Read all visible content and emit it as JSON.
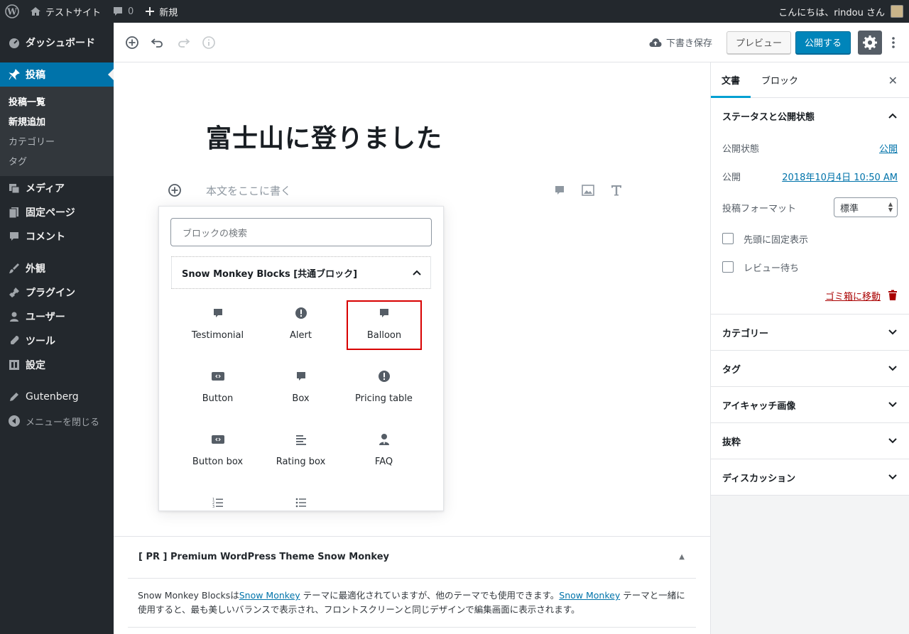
{
  "adminbar": {
    "site_name": "テストサイト",
    "comments_count": "0",
    "new_label": "新規",
    "greeting": "こんにちは、rindou さん"
  },
  "menu": {
    "dashboard": "ダッシュボード",
    "posts": "投稿",
    "sub": [
      "投稿一覧",
      "新規追加",
      "カテゴリー",
      "タグ"
    ],
    "media": "メディア",
    "pages": "固定ページ",
    "comments": "コメント",
    "appearance": "外観",
    "plugins": "プラグイン",
    "users": "ユーザー",
    "tools": "ツール",
    "settings": "設定",
    "gutenberg": "Gutenberg",
    "collapse": "メニューを閉じる"
  },
  "header": {
    "save_draft": "下書き保存",
    "preview": "プレビュー",
    "publish": "公開する"
  },
  "editor": {
    "title": "富士山に登りました",
    "placeholder": "本文をここに書く"
  },
  "inserter": {
    "search_placeholder": "ブロックの検索",
    "panel_title": "Snow Monkey Blocks [共通ブロック]",
    "blocks": [
      "Testimonial",
      "Alert",
      "Balloon",
      "Button",
      "Box",
      "Pricing table",
      "Button box",
      "Rating box",
      "FAQ"
    ]
  },
  "pr": {
    "title": "[ PR ] Premium WordPress Theme Snow Monkey",
    "text1": "Snow Monkey Blocksは",
    "link1": "Snow Monkey",
    "text2": " テーマに最適化されていますが、他のテーマでも使用できます。",
    "link2": "Snow Monkey",
    "text3": " テーマと一緒に使用すると、最も美しいバランスで表示され、フロントスクリーンと同じデザインで編集画面に表示されます。"
  },
  "sidebar": {
    "tab_document": "文書",
    "tab_block": "ブロック",
    "status_title": "ステータスと公開状態",
    "visibility_label": "公開状態",
    "visibility_value": "公開",
    "publish_label": "公開",
    "publish_value": "2018年10月4日 10:50 AM",
    "format_label": "投稿フォーマット",
    "format_value": "標準",
    "sticky_label": "先頭に固定表示",
    "pending_label": "レビュー待ち",
    "trash_label": "ゴミ箱に移動",
    "panels": [
      "カテゴリー",
      "タグ",
      "アイキャッチ画像",
      "抜粋",
      "ディスカッション"
    ]
  },
  "colors": {
    "accent": "#0073aa",
    "publish": "#0085ba",
    "highlight": "#d80000",
    "admin_dark": "#23282d"
  }
}
